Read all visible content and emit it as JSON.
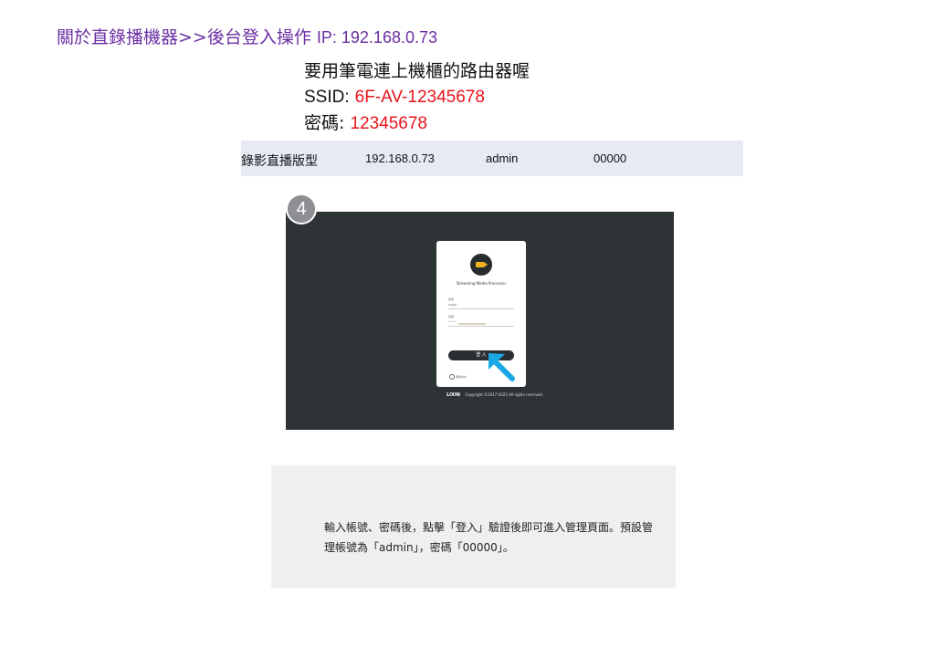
{
  "heading": {
    "title": "關於直錄播機器>>後台登入操作",
    "ip_label": "IP: 192.168.0.73"
  },
  "instruction": {
    "line1": "要用筆電連上機櫃的路由器喔",
    "ssid_label": "SSID:",
    "ssid_value": "6F-AV-12345678",
    "password_label": "密碼:",
    "password_value": "12345678"
  },
  "info_table": {
    "cells": [
      "錄影直播版型",
      "192.168.0.73",
      "admin",
      "00000"
    ]
  },
  "step": {
    "number": "4"
  },
  "screenshot": {
    "product_name": "Streaming Media Processor",
    "username_label": "帳號",
    "username_value": "admin",
    "password_label": "密碼",
    "password_value": "•••••",
    "login_button": "登 入",
    "language": "繁體中文",
    "footer_brand": "LIXIN",
    "footer_copyright": "Copyright ©2017-2023 All rights reserved."
  },
  "note": {
    "text": "輸入帳號、密碼後，點擊「登入」驗證後即可進入管理頁面。預設管理帳號為「admin」，密碼「00000」。"
  },
  "colors": {
    "heading": "#6b2fa3",
    "highlight": "#e8141b",
    "table_bg": "#e7eaf4",
    "arrow": "#1aa7e6"
  }
}
